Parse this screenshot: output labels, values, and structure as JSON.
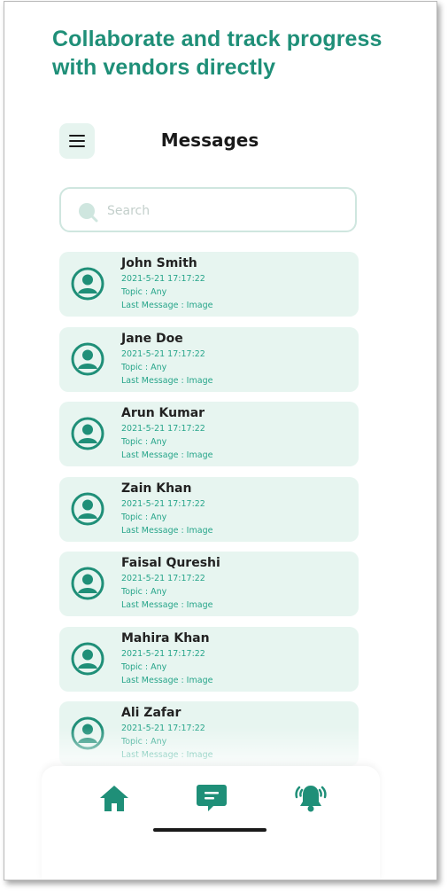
{
  "headline": {
    "line1": "Collaborate and track progress",
    "line2": "with vendors directly"
  },
  "header": {
    "menu_icon": "hamburger-menu-icon",
    "title": "Messages"
  },
  "search": {
    "icon": "search-icon",
    "placeholder": "Search",
    "value": ""
  },
  "conversations": [
    {
      "name": "John Smith",
      "date": "2021-5-21 17:17:22",
      "topic": "Topic : Any",
      "last_message": "Last Message : Image"
    },
    {
      "name": "Jane Doe",
      "date": "2021-5-21 17:17:22",
      "topic": "Topic : Any",
      "last_message": "Last Message : Image"
    },
    {
      "name": "Arun Kumar",
      "date": "2021-5-21 17:17:22",
      "topic": "Topic : Any",
      "last_message": "Last Message : Image"
    },
    {
      "name": "Zain Khan",
      "date": "2021-5-21 17:17:22",
      "topic": "Topic : Any",
      "last_message": "Last Message : Image"
    },
    {
      "name": "Faisal Qureshi",
      "date": "2021-5-21 17:17:22",
      "topic": "Topic : Any",
      "last_message": "Last Message : Image"
    },
    {
      "name": "Mahira Khan",
      "date": "2021-5-21 17:17:22",
      "topic": "Topic : Any",
      "last_message": "Last Message : Image"
    },
    {
      "name": "Ali Zafar",
      "date": "2021-5-21 17:17:22",
      "topic": "Topic : Any",
      "last_message": "Last Message : Image"
    }
  ],
  "bottom_nav": {
    "items": [
      {
        "icon": "home-icon"
      },
      {
        "icon": "messages-icon"
      },
      {
        "icon": "notification-bell-icon"
      }
    ]
  },
  "colors": {
    "accent": "#1f8f78",
    "card_bg": "#e7f5f0",
    "meta_text": "#27a58a"
  }
}
